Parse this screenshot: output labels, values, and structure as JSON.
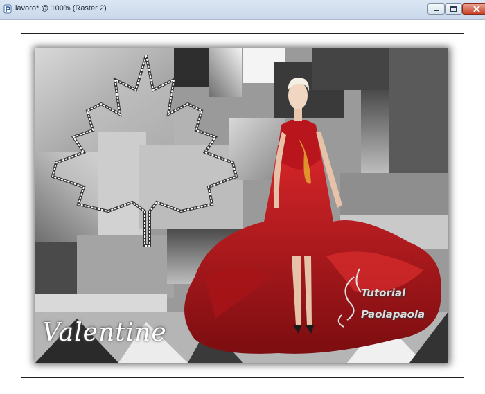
{
  "window": {
    "title": "lavoro* @ 100% (Raster 2)"
  },
  "canvas": {
    "title_text": "Valentine",
    "watermark_line1": "Tutorial",
    "watermark_line2": "Paolapaola"
  },
  "colors": {
    "titlebar": "#d0dcea",
    "dress_red": "#c0161c",
    "canvas_gray": "#9a9a9a"
  },
  "icons": [
    "app-icon",
    "minimize-icon",
    "maximize-icon",
    "close-icon",
    "maple-leaf-selection-icon",
    "swirl-ornament-icon"
  ]
}
